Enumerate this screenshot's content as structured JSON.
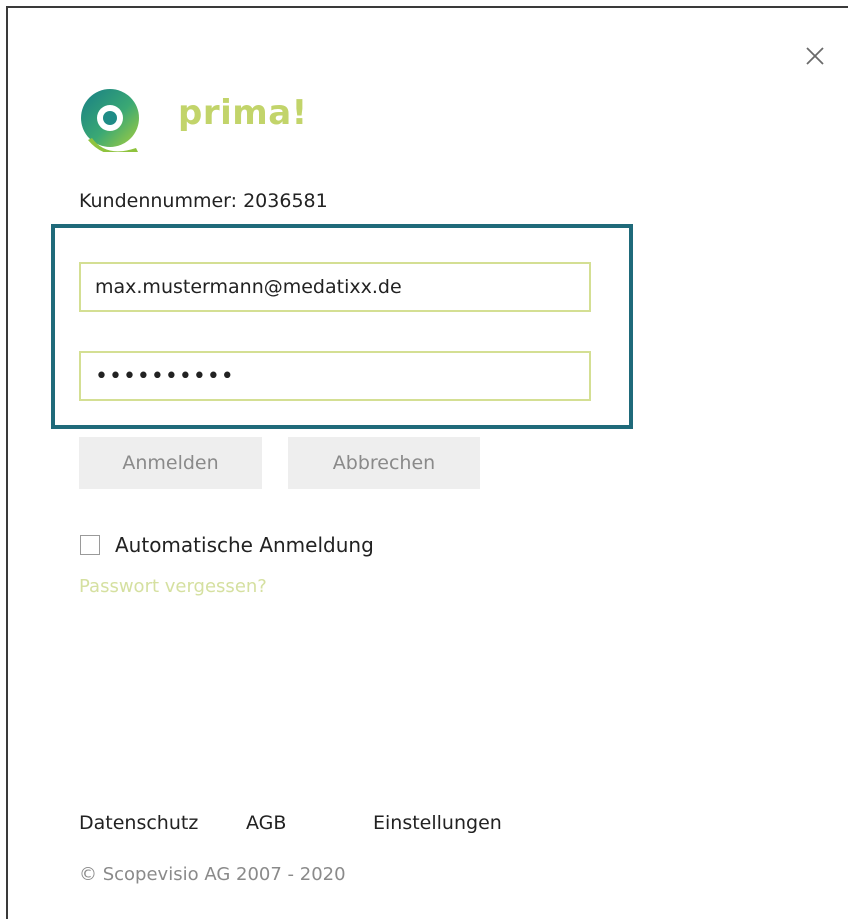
{
  "logo": {
    "name": "prima!",
    "color": "#c2d46a",
    "accent": "#1f8c86"
  },
  "close_icon": "close-icon",
  "customer": {
    "label": "Kundennummer: 2036581"
  },
  "login_form": {
    "email_value": "max.mustermann@medatixx.de",
    "password_mask": "••••••••••",
    "highlight_color": "#1f6a7a",
    "field_border_color": "#d4df93"
  },
  "buttons": {
    "login_label": "Anmelden",
    "cancel_label": "Abbrechen"
  },
  "auto_login": {
    "label": "Automatische Anmeldung",
    "checked": false
  },
  "forgot_password": {
    "label": "Passwort vergessen?"
  },
  "footer": {
    "privacy_label": "Datenschutz",
    "terms_label": "AGB",
    "settings_label": "Einstellungen",
    "copyright": "© Scopevisio AG 2007 - 2020"
  }
}
